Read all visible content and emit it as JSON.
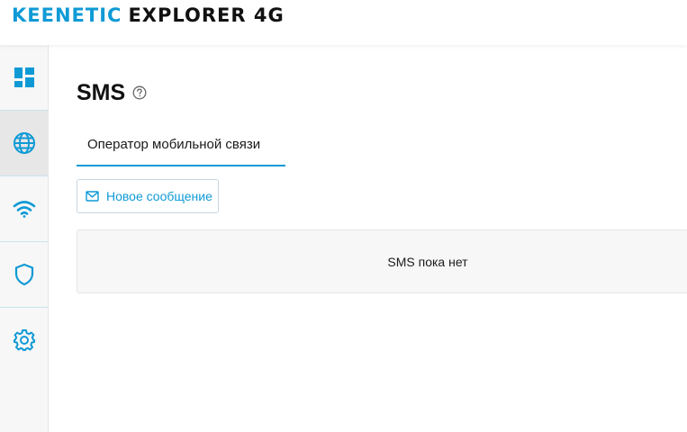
{
  "header": {
    "brand_primary": "KEENETIC",
    "brand_secondary": "EXPLORER 4G"
  },
  "sidebar": {
    "items": [
      {
        "name": "dashboard",
        "icon": "dashboard-icon",
        "active": false
      },
      {
        "name": "internet",
        "icon": "globe-icon",
        "active": true
      },
      {
        "name": "wifi",
        "icon": "wifi-icon",
        "active": false
      },
      {
        "name": "security",
        "icon": "shield-icon",
        "active": false
      },
      {
        "name": "settings",
        "icon": "gear-icon",
        "active": false
      }
    ]
  },
  "main": {
    "title": "SMS",
    "tabs": [
      {
        "label": "Оператор мобильной связи",
        "active": true
      }
    ],
    "new_message_label": "Новое сообщение",
    "empty_text": "SMS пока нет"
  },
  "colors": {
    "accent": "#0f9ad6",
    "sidebar_bg": "#f7f7f7",
    "active_nav_bg": "#e7e7e7"
  }
}
